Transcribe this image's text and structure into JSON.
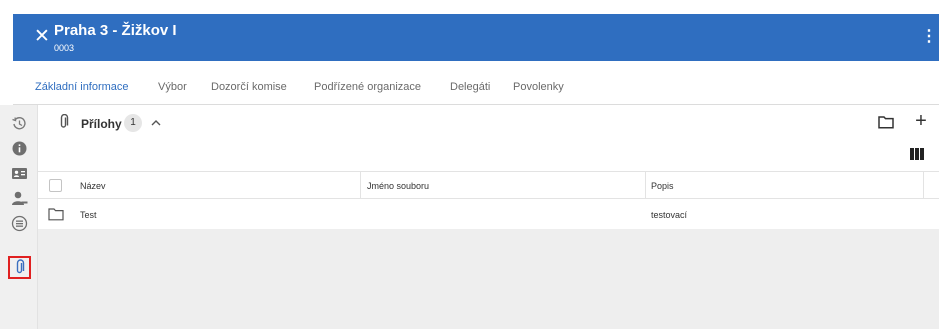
{
  "header": {
    "title": "Praha 3 - Žižkov I",
    "code": "0003",
    "close_icon": "close-icon",
    "menu_icon": "kebab-menu-icon",
    "color": "#2f6ec0"
  },
  "tabs": [
    {
      "label": "Základní informace",
      "active": true
    },
    {
      "label": "Výbor",
      "active": false
    },
    {
      "label": "Dozorčí komise",
      "active": false
    },
    {
      "label": "Podřízené organizace",
      "active": false
    },
    {
      "label": "Delegáti",
      "active": false
    },
    {
      "label": "Povolenky",
      "active": false
    }
  ],
  "sidebar": {
    "items": [
      {
        "icon": "history-icon"
      },
      {
        "icon": "info-icon"
      },
      {
        "icon": "contact-card-icon"
      },
      {
        "icon": "person-key-icon"
      },
      {
        "icon": "list-icon"
      },
      {
        "icon": "paperclip-icon",
        "selected": true
      }
    ]
  },
  "panel": {
    "title": "Přílohy",
    "count": "1",
    "collapse_icon": "chevron-up-icon",
    "actions": [
      "folder-icon",
      "plus-icon",
      "columns-icon"
    ],
    "plus_label": "+"
  },
  "table": {
    "headers": [
      "Název",
      "Jméno souboru",
      "Popis"
    ],
    "rows": [
      {
        "name": "Test",
        "filename": "",
        "description": "testovací"
      }
    ]
  }
}
